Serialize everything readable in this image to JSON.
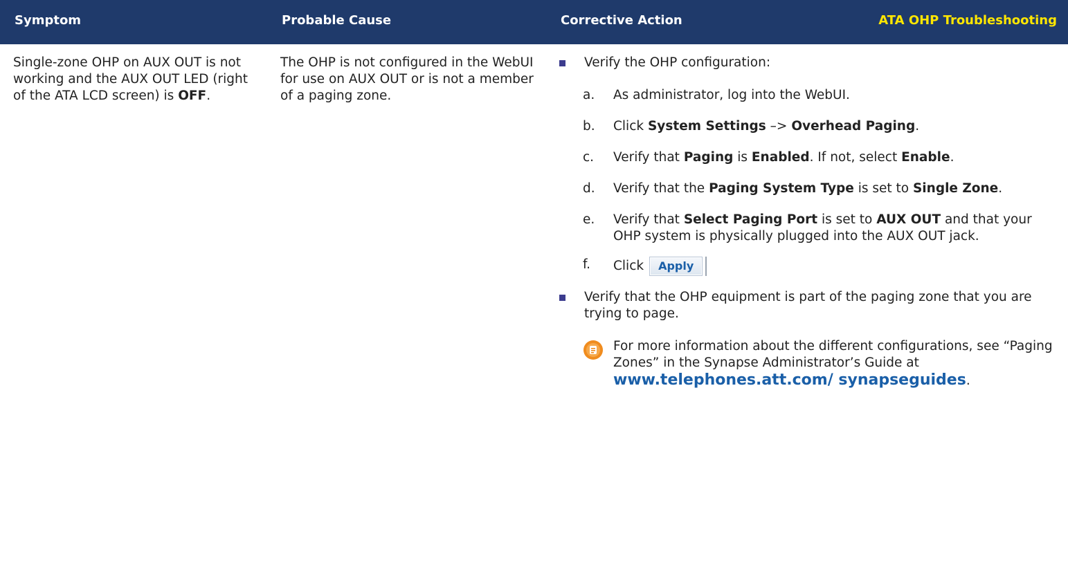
{
  "header": {
    "symptom": "Symptom",
    "probable_cause": "Probable Cause",
    "corrective_action": "Corrective Action",
    "section_title": "ATA OHP Troubleshooting"
  },
  "row": {
    "symptom_pre": "Single-zone OHP on AUX OUT is not working and the AUX OUT LED (right of the ATA LCD screen) is ",
    "symptom_bold": "OFF",
    "symptom_post": ".",
    "cause": "The OHP is not configured in the WebUI for use on AUX OUT or is not a member of a paging zone.",
    "bullet1": "Verify the OHP configuration:",
    "steps": {
      "a_letter": "a.",
      "a_text": "As administrator, log into the WebUI.",
      "b_letter": "b.",
      "b_text1": "Click ",
      "b_bold1": "System Settings",
      "b_text2": " –> ",
      "b_bold2": "Overhead Paging",
      "b_text3": ".",
      "c_letter": "c.",
      "c_text1": "Verify that ",
      "c_bold1": "Paging",
      "c_text2": " is ",
      "c_bold2": "Enabled",
      "c_text3": ". If not, select ",
      "c_bold3": "Enable",
      "c_text4": ".",
      "d_letter": "d.",
      "d_text1": "Verify that the ",
      "d_bold1": "Paging System Type",
      "d_text2": " is set to ",
      "d_bold2": "Single Zone",
      "d_text3": ".",
      "e_letter": "e.",
      "e_text1": "Verify that ",
      "e_bold1": "Select Paging Port",
      "e_text2": " is set to ",
      "e_bold2": "AUX OUT",
      "e_text3": " and that your OHP system is physically plugged into the AUX OUT jack.",
      "f_letter": "f.",
      "f_text": "Click",
      "apply_label": "Apply"
    },
    "bullet2": "Verify that the OHP equipment is part of the paging zone that you are trying to page.",
    "note_text": "For more information about the different configurations, see “Paging Zones” in the Synapse Administrator’s Guide at ",
    "note_link": "www.telephones.att.com/ synapseguides",
    "note_end": "."
  },
  "colors": {
    "header_bg": "#1f3a6b",
    "header_title": "#ffe600",
    "link": "#1a5fa8",
    "bullet": "#3c3c8e"
  },
  "icons": {
    "note": "note-icon"
  }
}
